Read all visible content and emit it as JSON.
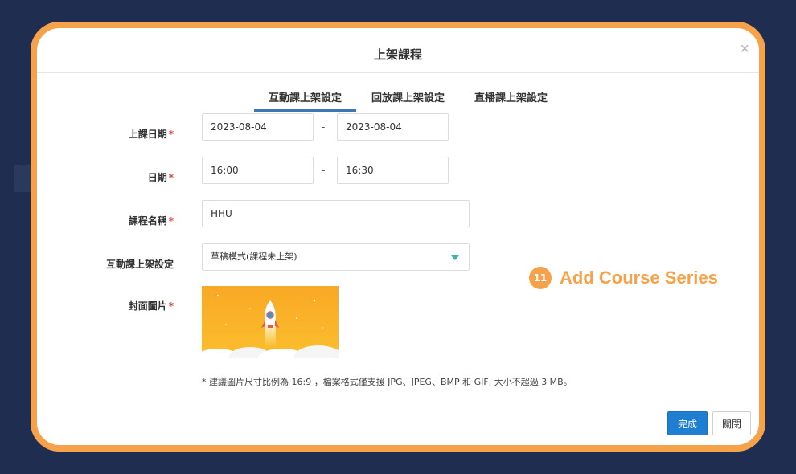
{
  "modal": {
    "title": "上架課程",
    "close_label": "×"
  },
  "tabs": [
    {
      "label": "互動課上架設定",
      "active": true
    },
    {
      "label": "回放課上架設定",
      "active": false
    },
    {
      "label": "直播課上架設定",
      "active": false
    }
  ],
  "form": {
    "class_date": {
      "label": "上課日期",
      "required": "*",
      "start": "2023-08-04",
      "end": "2023-08-04",
      "separator": "-"
    },
    "time": {
      "label": "日期",
      "required": "*",
      "start": "16:00",
      "end": "16:30",
      "separator": "-"
    },
    "course_name": {
      "label": "課程名稱",
      "required": "*",
      "value": "HHU"
    },
    "interactive_setting": {
      "label": "互動課上架設定",
      "selected": "草稿模式(課程未上架)"
    },
    "cover": {
      "label": "封面圖片",
      "required": "*",
      "hint": "* 建議圖片尺寸比例為 16:9 ，檔案格式僅支援 JPG、JPEG、BMP 和 GIF, 大小不超過 3 MB。"
    }
  },
  "annotation": {
    "number": "11",
    "text": "Add Course Series"
  },
  "footer": {
    "confirm_label": "完成",
    "close_label": "關閉"
  },
  "colors": {
    "frame": "#f6a24a",
    "primary": "#1e7fd2",
    "background": "#1e2d4f",
    "tab_underline": "#3a78b8"
  }
}
